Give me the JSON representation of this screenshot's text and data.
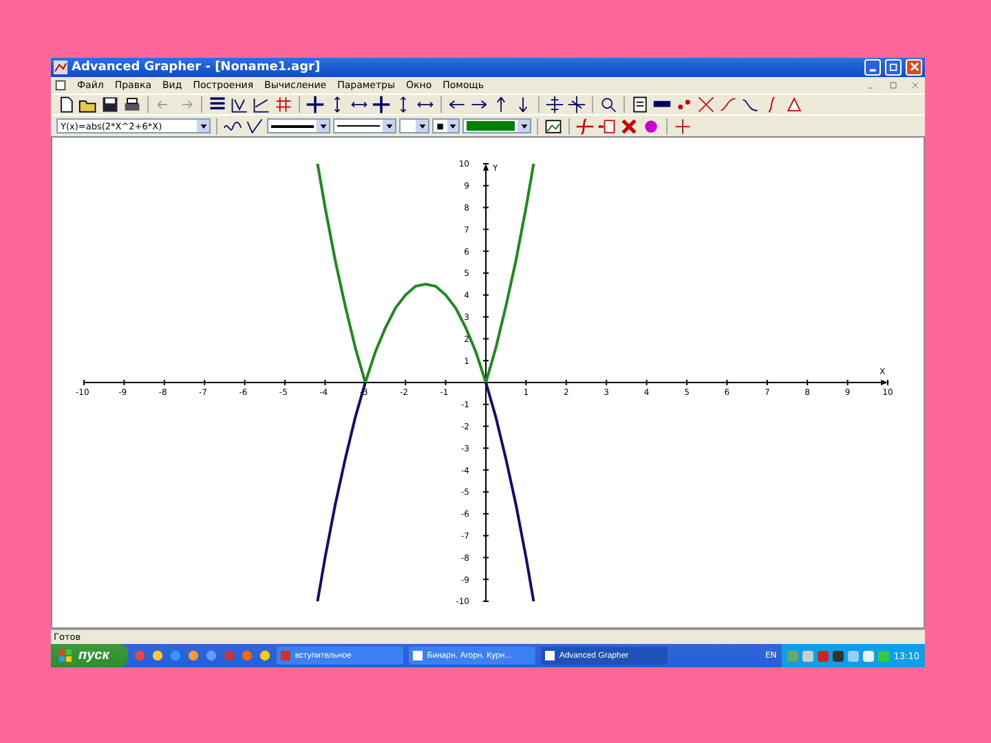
{
  "window": {
    "title": "Advanced Grapher - [Noname1.agr]"
  },
  "menu": [
    {
      "label": "Файл"
    },
    {
      "label": "Правка"
    },
    {
      "label": "Вид"
    },
    {
      "label": "Построения"
    },
    {
      "label": "Вычисление"
    },
    {
      "label": "Параметры"
    },
    {
      "label": "Окно"
    },
    {
      "label": "Помощь"
    }
  ],
  "formula_box": {
    "value": "Y(x)=abs(2*X^2+6*X)"
  },
  "graph": {
    "chart_data": {
      "type": "line",
      "xlabel": "X",
      "ylabel": "Y",
      "xlim": [
        -10,
        10
      ],
      "ylim": [
        -10,
        10
      ],
      "xticks": [
        -10,
        -9,
        -8,
        -7,
        -6,
        -5,
        -4,
        -3,
        -2,
        -1,
        1,
        2,
        3,
        4,
        5,
        6,
        7,
        8,
        9,
        10
      ],
      "yticks": [
        -10,
        -9,
        -8,
        -7,
        -6,
        -5,
        -4,
        -3,
        -2,
        -1,
        1,
        2,
        3,
        4,
        5,
        6,
        7,
        8,
        9,
        10
      ],
      "x": [
        -4.19,
        -4,
        -3.75,
        -3.5,
        -3.25,
        -3,
        -2.75,
        -2.5,
        -2.25,
        -2,
        -1.75,
        -1.5,
        -1.25,
        -1,
        -0.75,
        -0.5,
        -0.25,
        0,
        0.25,
        0.5,
        0.75,
        1,
        1.19
      ],
      "series": [
        {
          "color": "#1e8a1e",
          "values": [
            10,
            8,
            5.6,
            3.5,
            1.6,
            0,
            1.4,
            2.5,
            3.4,
            4,
            4.4,
            4.5,
            4.4,
            4,
            3.4,
            2.5,
            1.4,
            0,
            1.6,
            3.5,
            5.6,
            8,
            10
          ]
        },
        {
          "color": "#10106e",
          "values": [
            -10,
            -8,
            -5.6,
            -3.5,
            -1.6,
            0,
            null,
            null,
            null,
            null,
            null,
            null,
            null,
            null,
            null,
            null,
            null,
            0,
            -1.6,
            -3.5,
            -5.6,
            -8,
            -10
          ]
        }
      ]
    }
  },
  "status_bar": {
    "text": "Готов"
  },
  "taskbar": {
    "start": "пуск",
    "tasks": [
      {
        "label": "вступительное",
        "selected": false
      },
      {
        "label": "Бинарн. Агорн. Курн...",
        "selected": false
      },
      {
        "label": "Advanced Grapher",
        "selected": true
      }
    ],
    "language": "EN",
    "clock": "13:10"
  }
}
